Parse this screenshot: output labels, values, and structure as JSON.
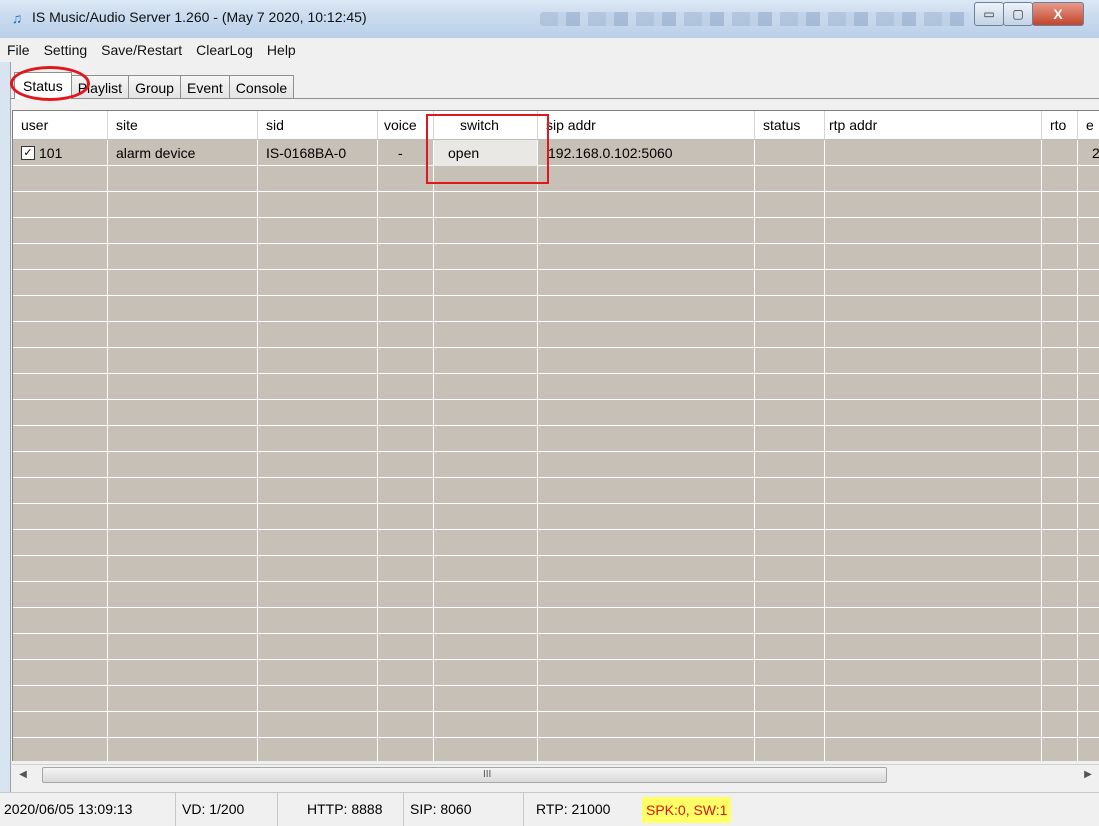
{
  "window": {
    "title": "IS Music/Audio Server 1.260 - (May  7 2020, 10:12:45)",
    "min_label": "▭",
    "max_label": "▢",
    "close_label": "X"
  },
  "menu": [
    "File",
    "Setting",
    "Save/Restart",
    "ClearLog",
    "Help"
  ],
  "tabs": [
    "Status",
    "Playlist",
    "Group",
    "Event",
    "Console"
  ],
  "active_tab": "Status",
  "table": {
    "columns": [
      "user",
      "site",
      "sid",
      "voice",
      "switch",
      "sip addr",
      "status",
      "rtp addr",
      "rto",
      "e"
    ],
    "rows": [
      {
        "checked": true,
        "user": "101",
        "site": "alarm device",
        "sid": "IS-0168BA-0",
        "voice": "-",
        "switch": "open",
        "sip_addr": "192.168.0.102:5060",
        "status": "",
        "rtp_addr": "",
        "rto": "",
        "e": "2"
      }
    ]
  },
  "scrollbar": {
    "grip": "III"
  },
  "statusbar": {
    "datetime": "2020/06/05 13:09:13",
    "vd": "VD: 1/200",
    "http": "HTTP: 8888",
    "sip": "SIP: 8060",
    "rtp": "RTP: 21000",
    "spk": "SPK:0, SW:1"
  },
  "colors": {
    "annotation": "#e0171c",
    "grid_bg": "#c7c0b6",
    "spk_bg": "#ffff66"
  }
}
